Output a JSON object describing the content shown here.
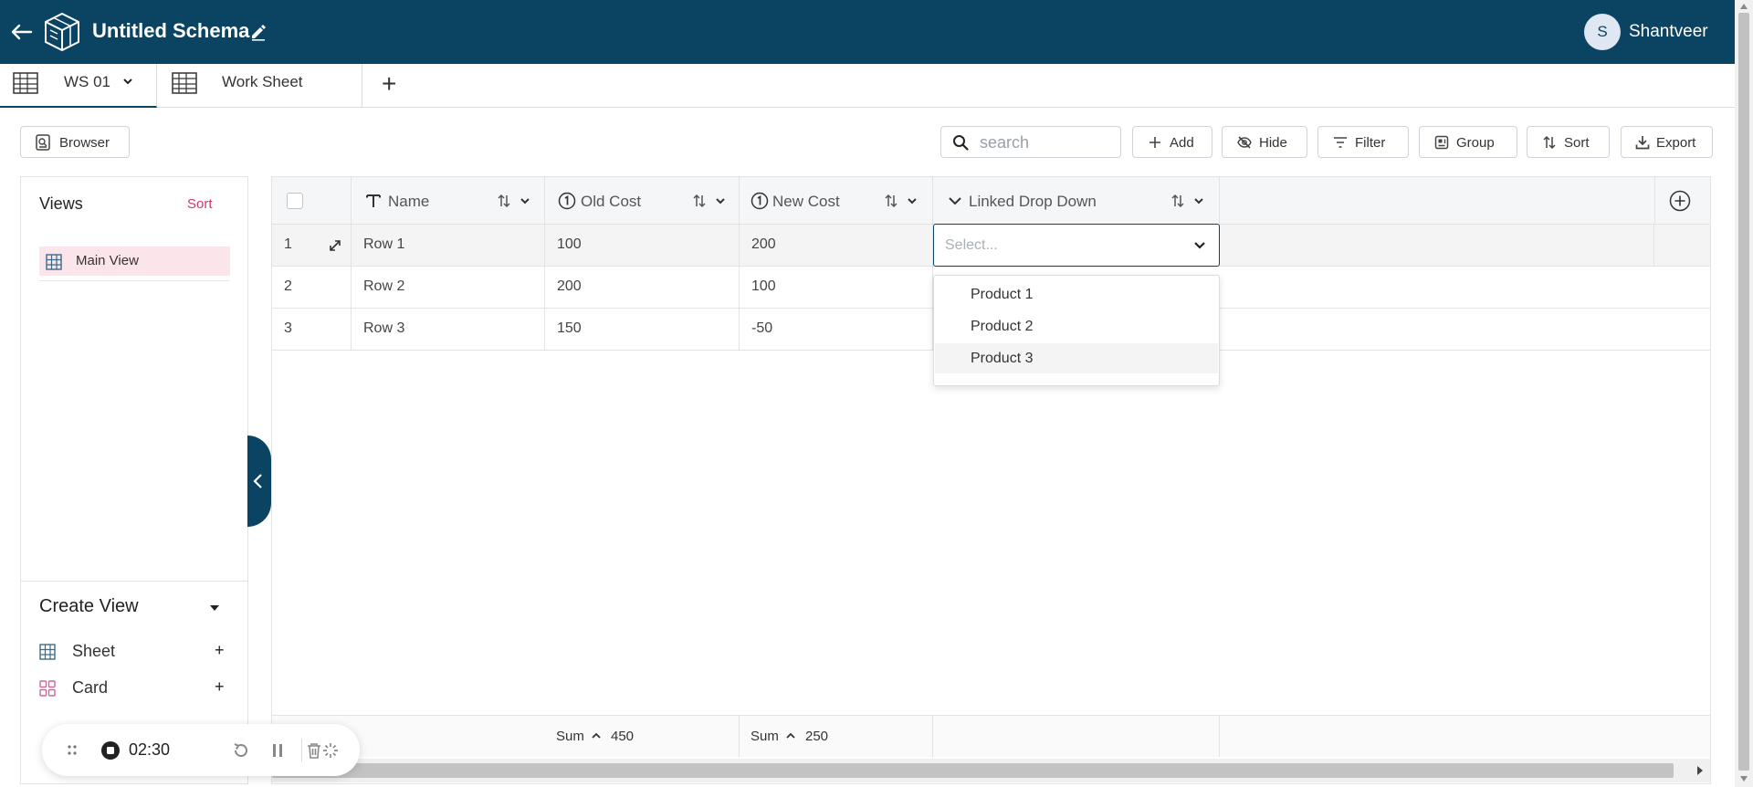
{
  "app": {
    "schema_title": "Untitled Schema",
    "user_initial": "S",
    "user_name": "Shantveer"
  },
  "tabs": [
    {
      "label": "WS 01",
      "active": true
    },
    {
      "label": "Work Sheet",
      "active": false
    }
  ],
  "toolbar": {
    "browser_label": "Browser",
    "search_placeholder": "search",
    "add_label": "Add",
    "hide_label": "Hide",
    "filter_label": "Filter",
    "group_label": "Group",
    "sort_label": "Sort",
    "export_label": "Export"
  },
  "views": {
    "title": "Views",
    "sort_label": "Sort",
    "items": [
      {
        "label": "Main View"
      }
    ]
  },
  "create_view": {
    "title": "Create View",
    "items": [
      {
        "label": "Sheet",
        "plus": "+"
      },
      {
        "label": "Card",
        "plus": "+"
      }
    ]
  },
  "grid": {
    "columns": [
      {
        "label": "Name",
        "type": "text"
      },
      {
        "label": "Old Cost",
        "type": "number"
      },
      {
        "label": "New Cost",
        "type": "number"
      },
      {
        "label": "Linked Drop Down",
        "type": "linked-dropdown"
      }
    ],
    "rows": [
      {
        "num": "1",
        "name": "Row 1",
        "old": "100",
        "new": "200"
      },
      {
        "num": "2",
        "name": "Row 2",
        "old": "200",
        "new": "100"
      },
      {
        "num": "3",
        "name": "Row 3",
        "old": "150",
        "new": "-50"
      }
    ],
    "select_placeholder": "Select...",
    "dropdown_options": [
      "Product 1",
      "Product 2",
      "Product 3"
    ],
    "footer": {
      "old_sum_label": "Sum",
      "old_sum_value": "450",
      "new_sum_label": "Sum",
      "new_sum_value": "250"
    }
  },
  "recorder": {
    "timer": "02:30"
  },
  "colors": {
    "brand": "#0b4462",
    "accent_pink": "#d0386a",
    "selected_view_bg": "#fbe4ea"
  }
}
